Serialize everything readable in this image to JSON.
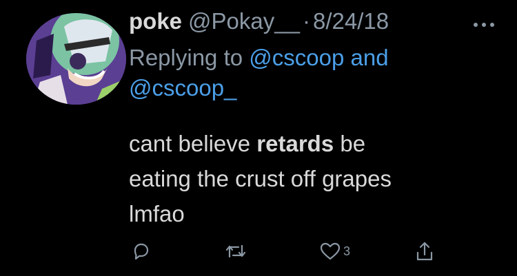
{
  "tweet": {
    "display_name": "poke",
    "handle": "@Pokay__",
    "separator": "·",
    "date": "8/24/18",
    "reply_prefix": "Replying to ",
    "reply_mention_1": "@cscoop and",
    "reply_mention_2": "@cscoop_",
    "text_1": "cant believe ",
    "text_bold": "retards",
    "text_2": " be",
    "text_line_2": "eating the crust off grapes",
    "text_line_3": "lmfao",
    "like_count": "3"
  },
  "icons": {
    "more": "more-horizontal-icon",
    "reply": "reply-icon",
    "retweet": "retweet-icon",
    "like": "heart-icon",
    "share": "share-icon"
  },
  "colors": {
    "background": "#000000",
    "text": "#d9d9d9",
    "muted": "#8b98a5",
    "link": "#4b9fe8"
  }
}
